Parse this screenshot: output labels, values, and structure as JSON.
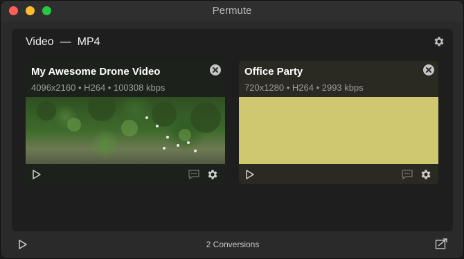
{
  "window": {
    "title": "Permute"
  },
  "panel": {
    "format_category": "Video",
    "separator": "—",
    "format_name": "MP4"
  },
  "files": [
    {
      "title": "My Awesome Drone Video",
      "meta": "4096x2160 • H264 • 100308 kbps",
      "thumbnail": "forest-drone-footage"
    },
    {
      "title": "Office Party",
      "meta": "720x1280 • H264 • 2993 kbps",
      "thumbnail": "yellow-frame"
    }
  ],
  "footer": {
    "status": "2 Conversions"
  },
  "colors": {
    "window_bg": "#2a2a2a",
    "panel_bg": "#1e1e1e",
    "close": "#ff5f57",
    "minimize": "#febc2e",
    "zoom": "#28c840",
    "office_thumb": "#d0c870"
  },
  "icons": {
    "panel_settings": "gear-icon",
    "card_close": "close-icon",
    "card_play": "play-icon",
    "card_subtitles": "speech-bubble-icon",
    "card_settings": "gear-icon",
    "footer_start": "play-icon",
    "footer_action": "export-icon"
  }
}
